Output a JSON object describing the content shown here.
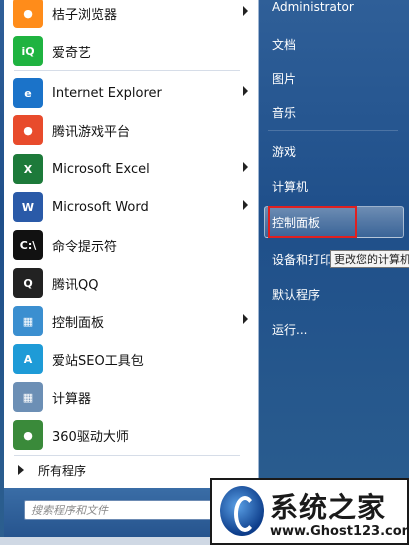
{
  "programs": [
    {
      "label": "桔子浏览器",
      "icon": "orange-browser-icon",
      "color": "#ff8c1a",
      "glyph": "●",
      "arrow": true
    },
    {
      "label": "爱奇艺",
      "icon": "iqiyi-icon",
      "color": "#1fb340",
      "glyph": "iQ",
      "arrow": false
    },
    {
      "label": "Internet Explorer",
      "icon": "internet-explorer-icon",
      "color": "#1b73c9",
      "glyph": "e",
      "arrow": true
    },
    {
      "label": "腾讯游戏平台",
      "icon": "tencent-games-icon",
      "color": "#e84b2c",
      "glyph": "●",
      "arrow": false
    },
    {
      "label": "Microsoft Excel",
      "icon": "excel-icon",
      "color": "#1d7a3a",
      "glyph": "X",
      "arrow": true
    },
    {
      "label": "Microsoft Word",
      "icon": "word-icon",
      "color": "#2a5aa8",
      "glyph": "W",
      "arrow": true
    },
    {
      "label": "命令提示符",
      "icon": "command-prompt-icon",
      "color": "#111111",
      "glyph": "C:\\",
      "arrow": false
    },
    {
      "label": "腾讯QQ",
      "icon": "qq-penguin-icon",
      "color": "#222222",
      "glyph": "Q",
      "arrow": false
    },
    {
      "label": "控制面板",
      "icon": "control-panel-icon",
      "color": "#3b8fd0",
      "glyph": "▦",
      "arrow": true
    },
    {
      "label": "爱站SEO工具包",
      "icon": "aizhan-seo-icon",
      "color": "#1e9bd7",
      "glyph": "A",
      "arrow": false
    },
    {
      "label": "计算器",
      "icon": "calculator-icon",
      "color": "#6c8fb5",
      "glyph": "▦",
      "arrow": false
    },
    {
      "label": "360驱动大师",
      "icon": "360-driver-icon",
      "color": "#3a8a3a",
      "glyph": "●",
      "arrow": false
    }
  ],
  "all_programs": "所有程序",
  "search_placeholder": "搜索程序和文件",
  "right_items": {
    "user": "Administrator",
    "documents": "文档",
    "pictures": "图片",
    "music": "音乐",
    "games": "游戏",
    "computer": "计算机",
    "control_panel": "控制面板",
    "devices": "设备和打印",
    "default_programs": "默认程序",
    "run": "运行..."
  },
  "tooltip": "更改您的计算机",
  "watermark": {
    "title": "系统之家",
    "url": "www.Ghost123.com"
  }
}
